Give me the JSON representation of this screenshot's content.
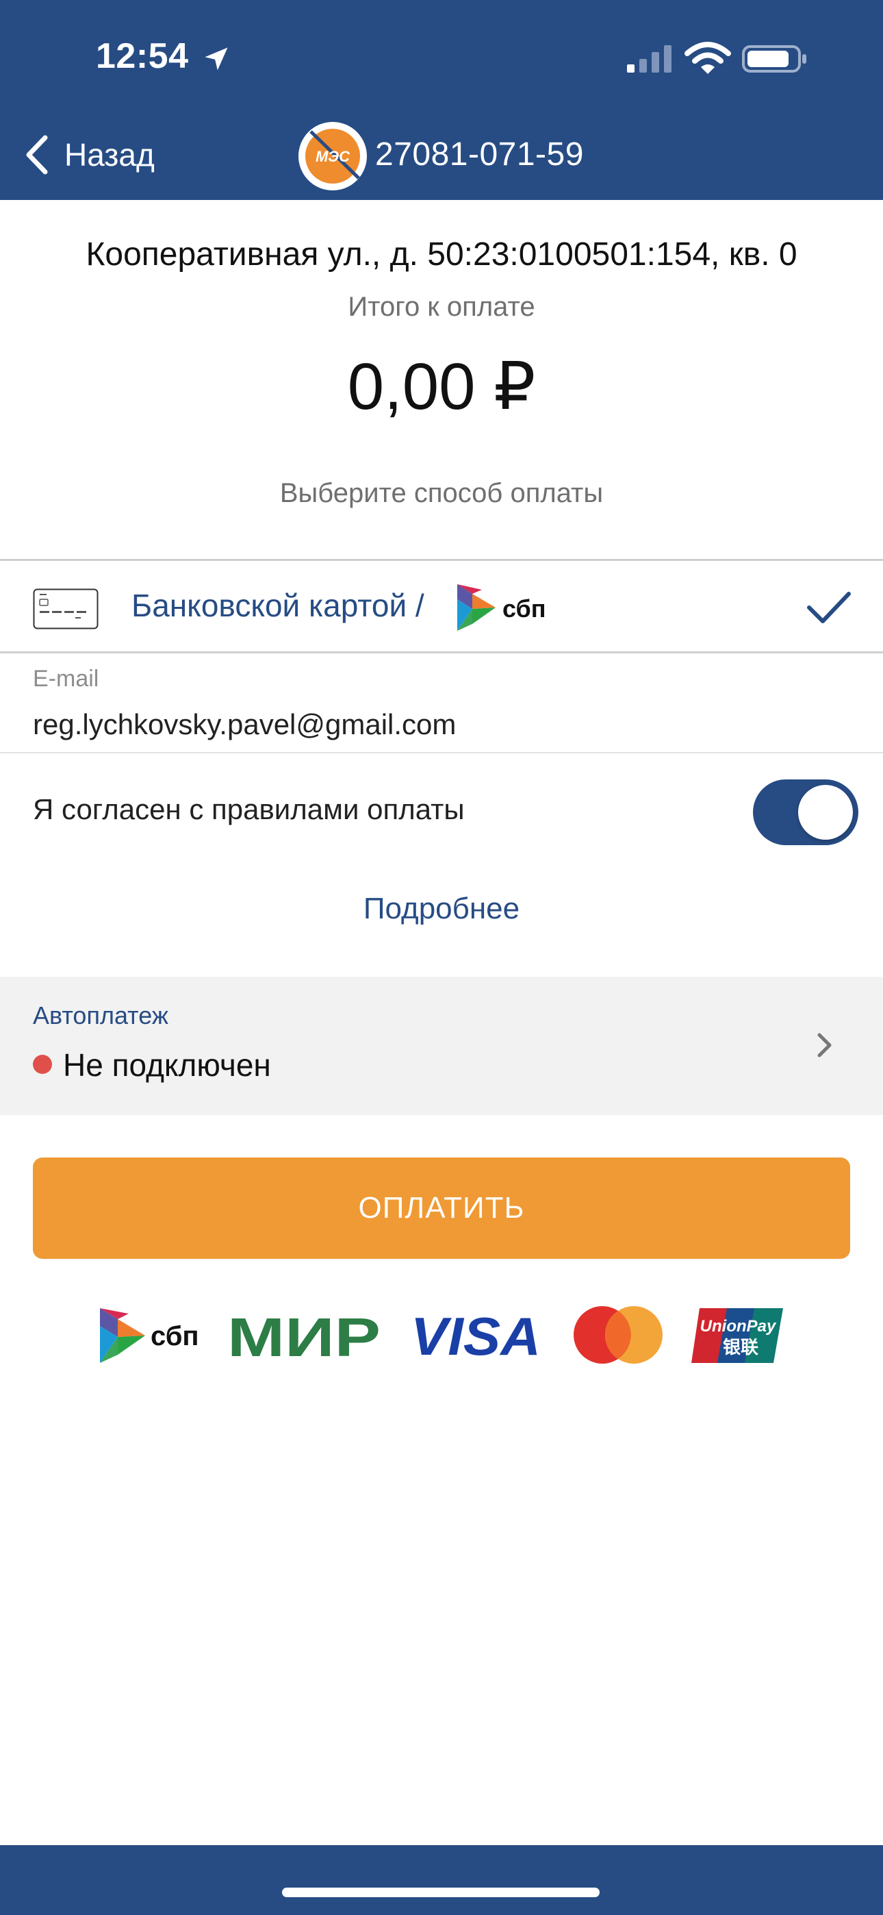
{
  "status_bar": {
    "time": "12:54",
    "icons": [
      "location-arrow-icon",
      "cellular-signal-icon",
      "wifi-icon",
      "battery-icon"
    ]
  },
  "nav": {
    "back_label": "Назад",
    "logo_text": "МЭС",
    "account_number": "27081-071-59"
  },
  "summary": {
    "address": "Кооперативная ул., д. 50:23:0100501:154, кв. 0",
    "total_label": "Итого к оплате",
    "amount": "0,00 ₽",
    "choose_method": "Выберите способ оплаты"
  },
  "payment_method": {
    "label": "Банковской картой /",
    "sbp_text": "сбп",
    "selected": true
  },
  "email": {
    "caption": "E-mail",
    "value": "reg.lychkovsky.pavel@gmail.com"
  },
  "agreement": {
    "label": "Я согласен с правилами оплаты",
    "enabled": true
  },
  "details_link": "Подробнее",
  "autopay": {
    "caption": "Автоплатеж",
    "status": "Не подключен",
    "status_color": "#e0504a"
  },
  "pay_button": {
    "label": "ОПЛАТИТЬ"
  },
  "payment_logos": {
    "sbp": "сбп",
    "mir": "МИР",
    "visa": "VISA",
    "mastercard": "mastercard-logo",
    "unionpay": "UnionPay",
    "unionpay_cn": "银联"
  },
  "colors": {
    "brand_blue": "#274c84",
    "accent_orange": "#ef9a35",
    "mir_green": "#2d7d46",
    "visa_blue": "#1a3fa6"
  }
}
